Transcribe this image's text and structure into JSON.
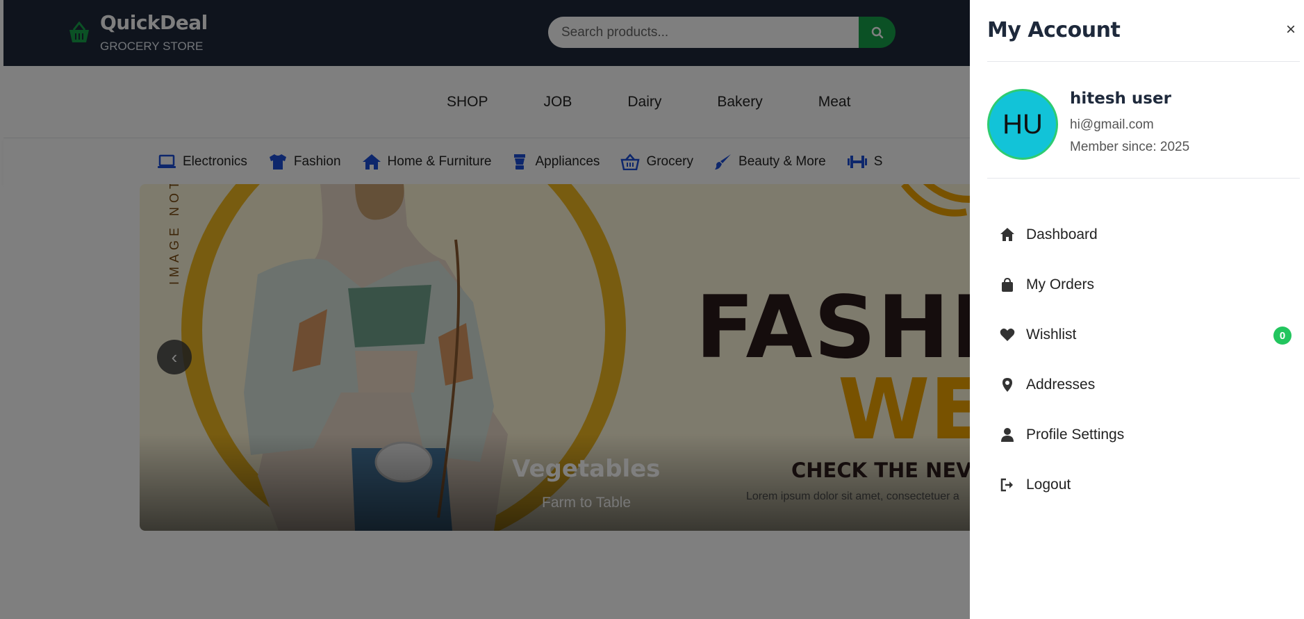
{
  "header": {
    "brand": "QuickDeal",
    "tagline": "GROCERY STORE",
    "search_placeholder": "Search products..."
  },
  "nav": {
    "links": [
      "SHOP",
      "JOB",
      "Dairy",
      "Bakery",
      "Meat"
    ]
  },
  "categories": [
    {
      "label": "Electronics",
      "icon": "laptop-icon"
    },
    {
      "label": "Fashion",
      "icon": "tshirt-icon"
    },
    {
      "label": "Home & Furniture",
      "icon": "home-icon"
    },
    {
      "label": "Appliances",
      "icon": "blender-icon"
    },
    {
      "label": "Grocery",
      "icon": "basket-icon"
    },
    {
      "label": "Beauty & More",
      "icon": "brush-icon"
    },
    {
      "label": "S",
      "icon": "dumbbell-icon"
    }
  ],
  "banner": {
    "vertical_text": "IMAGE NOT I",
    "headline_1": "FASHI",
    "headline_2": "WE",
    "caption_title": "Vegetables",
    "caption_subtitle": "Farm to Table",
    "promo": "CHECK THE NEV",
    "promo_body": "Lorem ipsum dolor sit amet, consectetuer a",
    "prev_arrow": "‹"
  },
  "drawer": {
    "title": "My Account",
    "close": "×",
    "user": {
      "initials": "HU",
      "name": "hitesh user",
      "email": "hi@gmail.com",
      "member_since": "Member since: 2025"
    },
    "menu": [
      {
        "label": "Dashboard",
        "icon": "home-icon"
      },
      {
        "label": "My Orders",
        "icon": "shopping-bag-icon"
      },
      {
        "label": "Wishlist",
        "icon": "heart-icon",
        "badge": "0"
      },
      {
        "label": "Addresses",
        "icon": "map-pin-icon"
      },
      {
        "label": "Profile Settings",
        "icon": "user-icon"
      },
      {
        "label": "Logout",
        "icon": "logout-icon"
      }
    ]
  },
  "colors": {
    "header_bg": "#1e293b",
    "accent_green": "#16a34a",
    "category_icon": "#1d4ed8",
    "avatar_bg": "#12c3d8",
    "badge_bg": "#22c55e"
  }
}
